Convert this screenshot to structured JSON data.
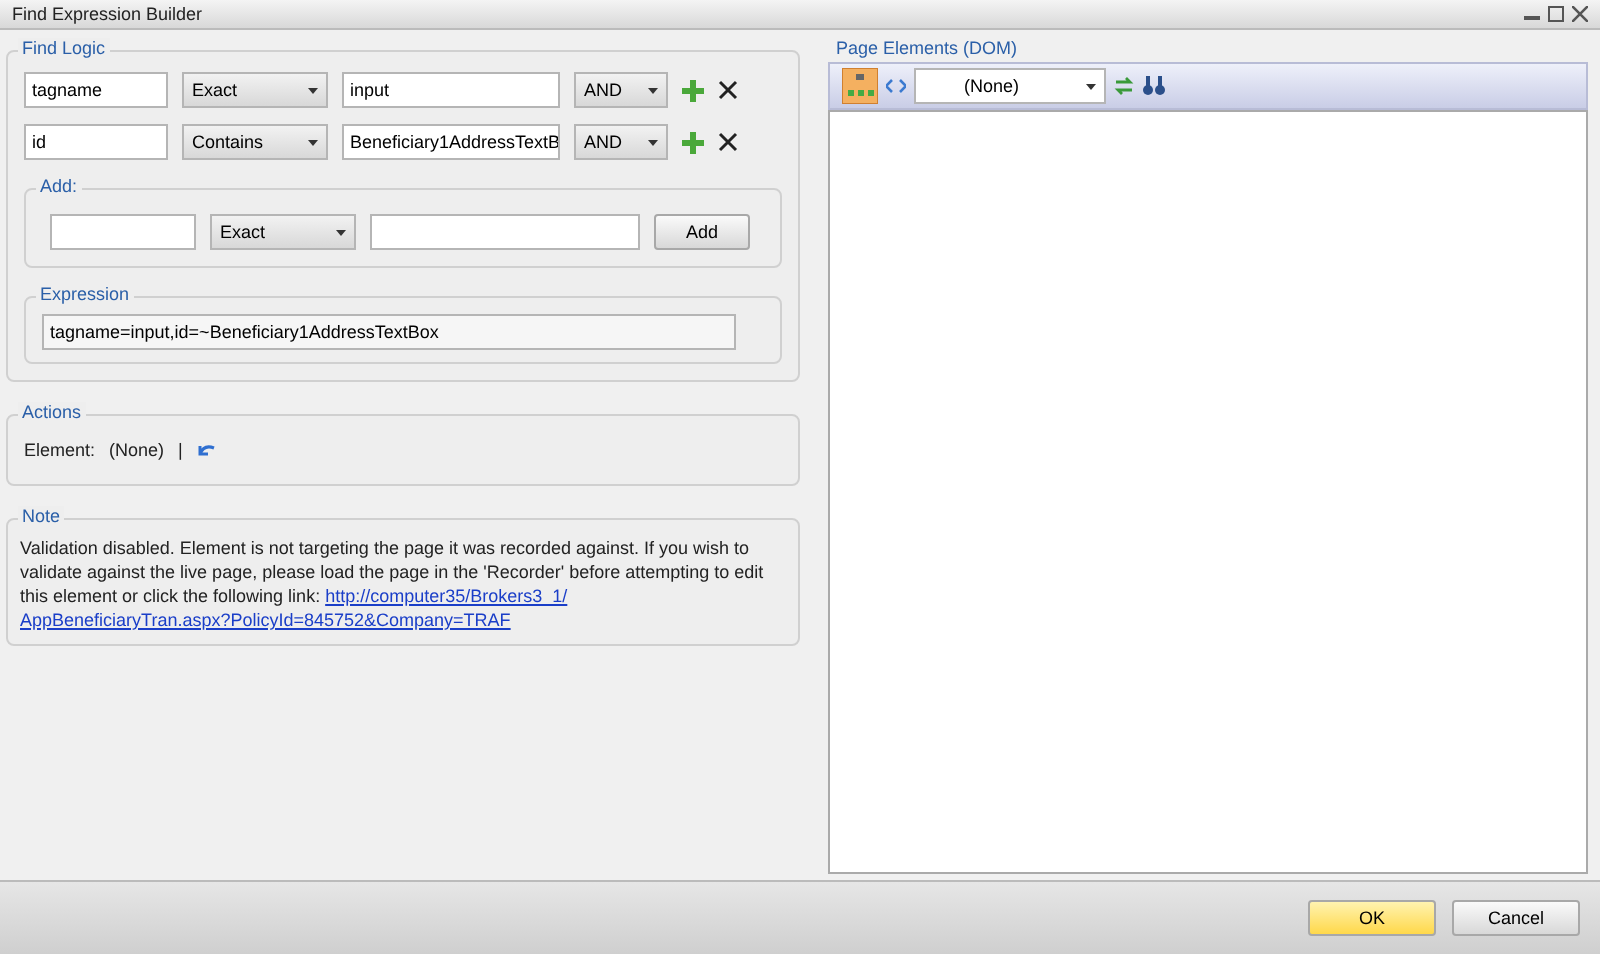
{
  "window": {
    "title": "Find Expression Builder"
  },
  "find_logic": {
    "title": "Find Logic",
    "rows": [
      {
        "attribute": "tagname",
        "comparison": "Exact",
        "value": "input",
        "join": "AND"
      },
      {
        "attribute": "id",
        "comparison": "Contains",
        "value": "Beneficiary1AddressTextB",
        "join": "AND"
      }
    ],
    "add": {
      "title": "Add:",
      "comparison": "Exact",
      "button": "Add"
    },
    "expression": {
      "title": "Expression",
      "value": "tagname=input,id=~Beneficiary1AddressTextBox"
    }
  },
  "actions": {
    "title": "Actions",
    "label": "Element:",
    "value": "(None)",
    "separator": "|"
  },
  "note": {
    "title": "Note",
    "text": "Validation disabled. Element is not targeting the page it was recorded against. If you wish to validate against the live page, please load the page in the 'Recorder' before attempting to edit this element or click the following link: ",
    "link_lines": [
      "http://computer35/Brokers3_1/",
      "AppBeneficiaryTran.aspx?PolicyId=845752&Company=TRAF"
    ]
  },
  "page_elements": {
    "title": "Page Elements (DOM)",
    "selector": "(None)"
  },
  "buttons": [
    {
      "label": "OK",
      "kind": "primary"
    },
    {
      "label": "Cancel",
      "kind": "normal"
    }
  ]
}
